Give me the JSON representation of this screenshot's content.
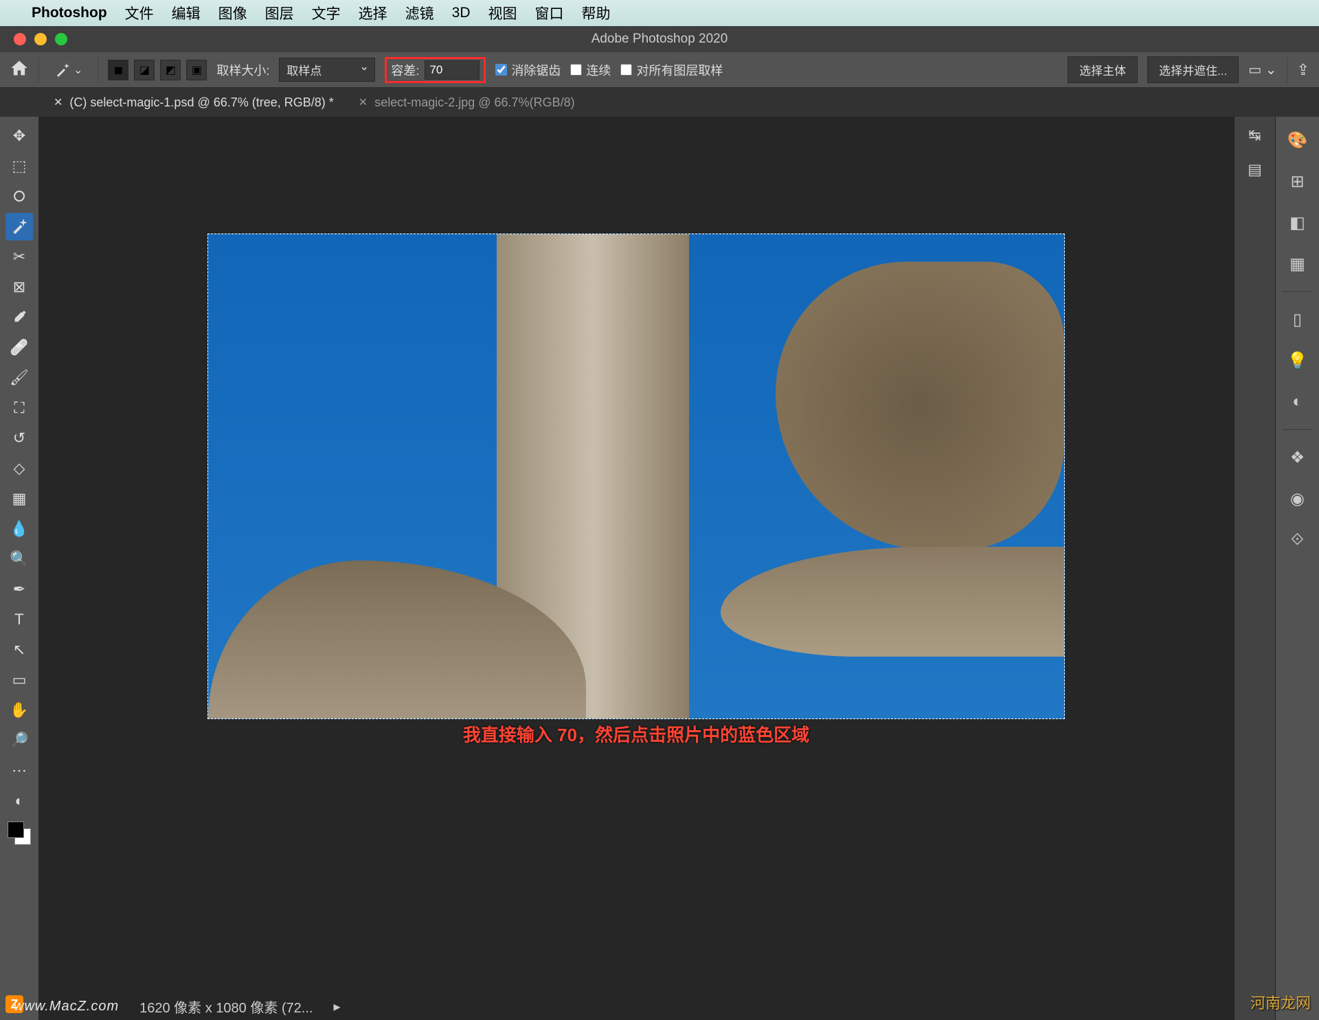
{
  "mac_menu": {
    "app": "Photoshop",
    "items": [
      "文件",
      "编辑",
      "图像",
      "图层",
      "文字",
      "选择",
      "滤镜",
      "3D",
      "视图",
      "窗口",
      "帮助"
    ]
  },
  "window": {
    "title": "Adobe Photoshop 2020"
  },
  "options": {
    "sample_label": "取样大小:",
    "sample_value": "取样点",
    "tolerance_label": "容差:",
    "tolerance_value": "70",
    "antialias": "消除锯齿",
    "contiguous": "连续",
    "all_layers": "对所有图层取样",
    "select_subject": "选择主体",
    "select_mask": "选择并遮住..."
  },
  "tabs": [
    {
      "label": "(C) select-magic-1.psd @ 66.7% (tree, RGB/8) *",
      "active": true
    },
    {
      "label": "select-magic-2.jpg @ 66.7%(RGB/8)",
      "active": false
    }
  ],
  "caption": "我直接输入 70，然后点击照片中的蓝色区域",
  "status": {
    "watermark_left": "www.MacZ.com",
    "info": "1620 像素 x 1080 像素 (72...",
    "watermark_right": "河南龙网",
    "z": "Z"
  },
  "tools": [
    "move",
    "marquee",
    "lasso",
    "magic-wand",
    "crop",
    "frame",
    "eyedropper",
    "heal",
    "brush",
    "stamp",
    "history-brush",
    "eraser",
    "gradient",
    "blur",
    "dodge",
    "pen",
    "type",
    "path",
    "shape",
    "hand",
    "zoom",
    "more"
  ],
  "right_icons": [
    "color",
    "swatches",
    "gradients",
    "patterns",
    "properties",
    "adjustments",
    "libraries",
    "layers",
    "channels",
    "paths"
  ]
}
